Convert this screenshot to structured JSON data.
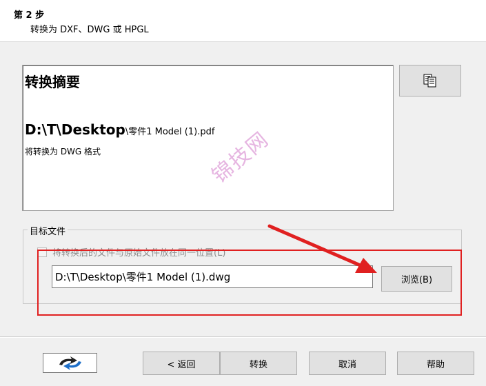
{
  "header": {
    "step_title": "第 2 步",
    "step_subtitle": "转换为 DXF、DWG 或 HPGL"
  },
  "summary": {
    "heading": "转换摘要",
    "source_path_folder": "D:\\T\\Desktop",
    "source_path_file": "\\零件1 Model (1).pdf",
    "note": "将转换为 DWG 格式"
  },
  "copy_button_icon": "copy-clipboard-icon",
  "target_group": {
    "label": "目标文件",
    "checkbox_label": "将转换后的文件与原始文件放在同一位置(L)",
    "checkbox_checked": false,
    "output_path": "D:\\T\\Desktop\\零件1 Model (1).dwg",
    "browse_label": "浏览(B)"
  },
  "watermark": "锦技网",
  "annotation": {
    "highlight_color": "#e02020"
  },
  "footer": {
    "logo_icon": "app-logo-icon",
    "back_label": "< 返回",
    "convert_label": "转换",
    "cancel_label": "取消",
    "help_label": "帮助"
  }
}
